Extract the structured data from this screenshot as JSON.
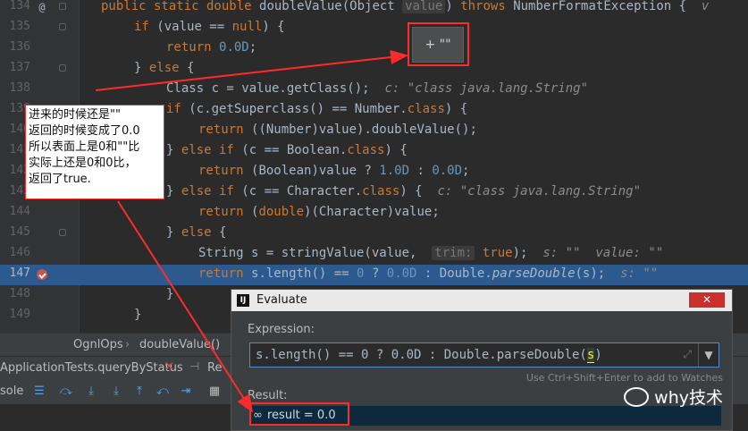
{
  "editor": {
    "lines": [
      {
        "num": "134",
        "html_parts": [
          {
            "c": "kw",
            "t": "public static double "
          },
          {
            "c": "",
            "t": "doubleValue(Object "
          },
          {
            "c": "hint",
            "t": "value"
          },
          {
            "c": "",
            "t": ") "
          },
          {
            "c": "kw",
            "t": "throws "
          },
          {
            "c": "",
            "t": "NumberFormatException {  "
          },
          {
            "c": "inl",
            "t": "v"
          }
        ]
      },
      {
        "num": "135",
        "html_parts": [
          {
            "c": "kw",
            "t": "if "
          },
          {
            "c": "",
            "t": "(value == "
          },
          {
            "c": "kw",
            "t": "null"
          },
          {
            "c": "",
            "t": ") {"
          }
        ]
      },
      {
        "num": "136",
        "html_parts": [
          {
            "c": "kw",
            "t": "return "
          },
          {
            "c": "num",
            "t": "0.0D"
          },
          {
            "c": "",
            "t": ";"
          }
        ]
      },
      {
        "num": "137",
        "html_parts": [
          {
            "c": "",
            "t": "} "
          },
          {
            "c": "kw",
            "t": "else "
          },
          {
            "c": "",
            "t": "{"
          }
        ]
      },
      {
        "num": "138",
        "html_parts": [
          {
            "c": "",
            "t": "Class c = value.getClass();  "
          },
          {
            "c": "inl",
            "t": "c: \"class java.lang.String\""
          }
        ]
      },
      {
        "num": "139",
        "html_parts": [
          {
            "c": "kw",
            "t": "if "
          },
          {
            "c": "",
            "t": "(c.getSuperclass() == Number."
          },
          {
            "c": "kw",
            "t": "class"
          },
          {
            "c": "",
            "t": ") {"
          }
        ]
      },
      {
        "num": "140",
        "html_parts": [
          {
            "c": "kw",
            "t": "return "
          },
          {
            "c": "",
            "t": "((Number)value).doubleValue();"
          }
        ]
      },
      {
        "num": "141",
        "html_parts": [
          {
            "c": "",
            "t": "} "
          },
          {
            "c": "kw",
            "t": "else if "
          },
          {
            "c": "",
            "t": "(c == Boolean."
          },
          {
            "c": "kw",
            "t": "class"
          },
          {
            "c": "",
            "t": ") {"
          }
        ]
      },
      {
        "num": "142",
        "html_parts": [
          {
            "c": "kw",
            "t": "return "
          },
          {
            "c": "",
            "t": "(Boolean)value ? "
          },
          {
            "c": "num",
            "t": "1.0D"
          },
          {
            "c": "",
            "t": " : "
          },
          {
            "c": "num",
            "t": "0.0D"
          },
          {
            "c": "",
            "t": ";"
          }
        ]
      },
      {
        "num": "143",
        "html_parts": [
          {
            "c": "",
            "t": "} "
          },
          {
            "c": "kw",
            "t": "else if "
          },
          {
            "c": "",
            "t": "(c == Character."
          },
          {
            "c": "kw",
            "t": "class"
          },
          {
            "c": "",
            "t": ") {  "
          },
          {
            "c": "inl",
            "t": "c: \"class java.lang.String\""
          }
        ]
      },
      {
        "num": "144",
        "html_parts": [
          {
            "c": "kw",
            "t": "return "
          },
          {
            "c": "",
            "t": "("
          },
          {
            "c": "kw",
            "t": "double"
          },
          {
            "c": "",
            "t": ")(Character)value;"
          }
        ]
      },
      {
        "num": "145",
        "html_parts": [
          {
            "c": "",
            "t": "} "
          },
          {
            "c": "kw",
            "t": "else "
          },
          {
            "c": "",
            "t": "{"
          }
        ]
      },
      {
        "num": "146",
        "html_parts": [
          {
            "c": "",
            "t": "String s = stringValue(value,  "
          },
          {
            "c": "hint",
            "t": "trim:"
          },
          {
            "c": "",
            "t": " "
          },
          {
            "c": "kw",
            "t": "true"
          },
          {
            "c": "",
            "t": ");  "
          },
          {
            "c": "inl",
            "t": "s: \"\"  value: \"\""
          }
        ]
      },
      {
        "num": "147",
        "html_parts": [
          {
            "c": "kw",
            "t": "return "
          },
          {
            "c": "",
            "t": "s.length() == "
          },
          {
            "c": "num",
            "t": "0"
          },
          {
            "c": "",
            "t": " ? "
          },
          {
            "c": "num",
            "t": "0.0D"
          },
          {
            "c": "",
            "t": " : Double."
          },
          {
            "c": "ital",
            "t": "parseDouble"
          },
          {
            "c": "",
            "t": "(s);  "
          },
          {
            "c": "inl",
            "t": "s: \"\""
          }
        ]
      },
      {
        "num": "148",
        "html_parts": [
          {
            "c": "",
            "t": "}"
          }
        ]
      },
      {
        "num": "149",
        "html_parts": [
          {
            "c": "",
            "t": "}"
          }
        ]
      }
    ],
    "tooltip_text": "+ \"\""
  },
  "note": {
    "lines": [
      "进来的时候还是\"\"",
      "返回的时候变成了0.0",
      "所以表面上是0和\"\"比",
      "实际上还是0和0比，",
      "返回了true."
    ]
  },
  "breadcrumb": {
    "class_name": "OgnlOps",
    "method": "doubleValue()"
  },
  "run": {
    "tab_label": "ApplicationTests.queryByStatus",
    "tab2_label": "Re",
    "console_label": "sole"
  },
  "dialog": {
    "title": "Evaluate",
    "close_label": "✕",
    "expression_label": "Expression:",
    "expression_before": "s.length() == 0 ? 0.0D : Double.parseDouble(",
    "expression_cursor": "s",
    "expression_after": ")",
    "hint": "Use Ctrl+Shift+Enter to add to Watches",
    "result_label": "Result:",
    "result_text": "result = 0.0",
    "result_icon": "∞"
  },
  "watermark": {
    "text": "why技术"
  }
}
